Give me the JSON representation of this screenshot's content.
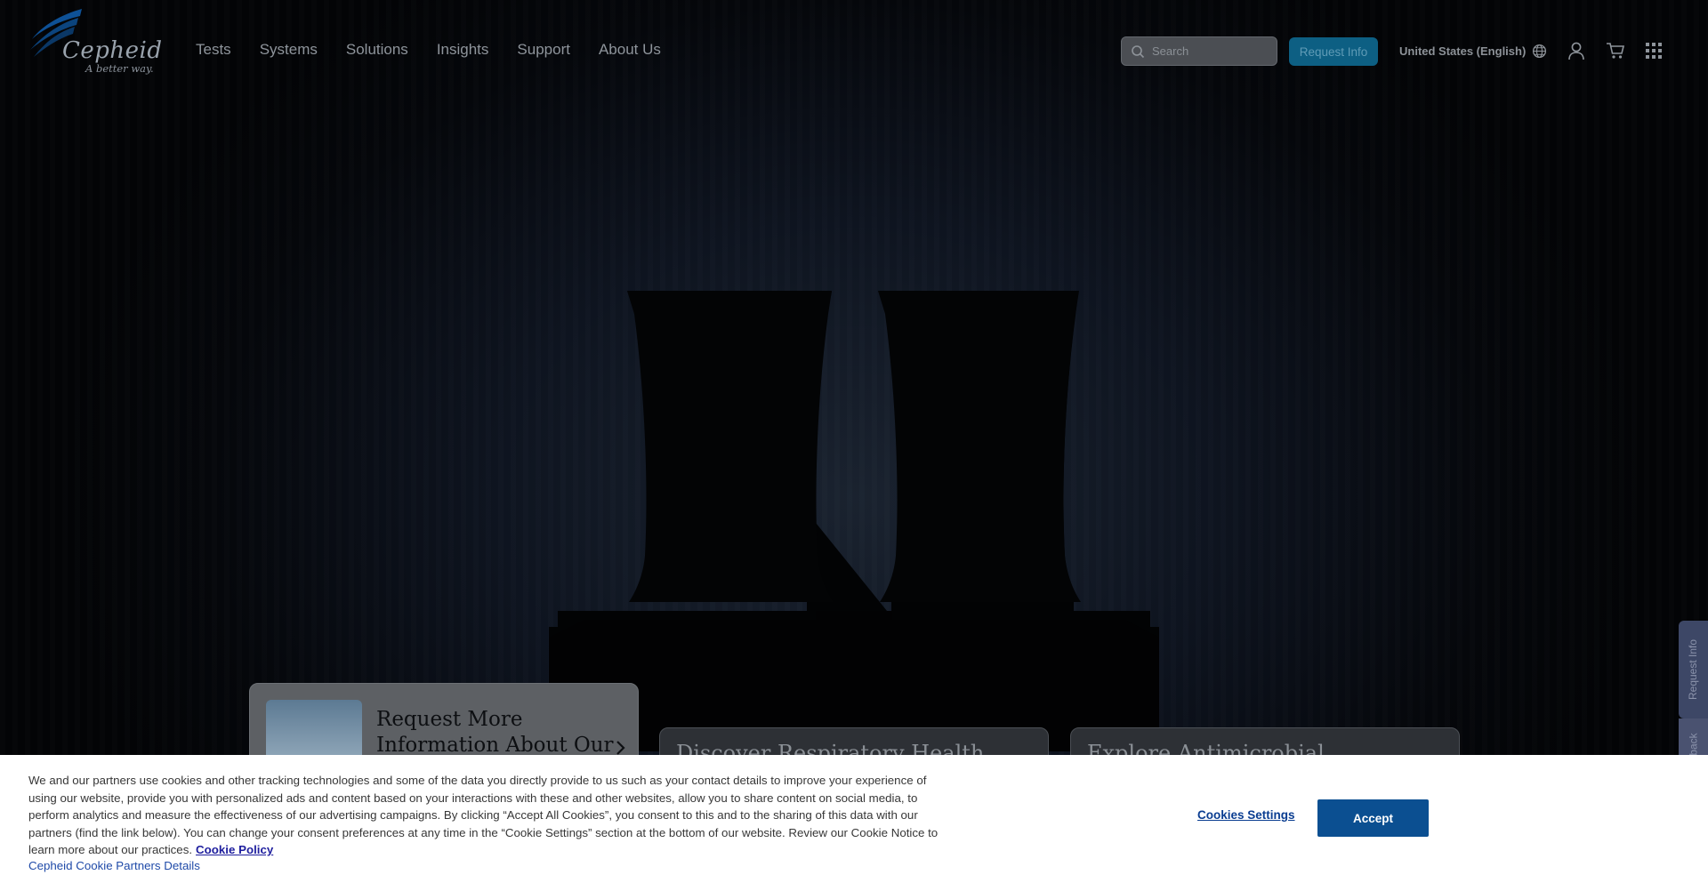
{
  "brand": {
    "name": "Cepheid",
    "tagline": "A better way.",
    "color": "#0f5aa6"
  },
  "nav": {
    "items": [
      {
        "label": "Tests"
      },
      {
        "label": "Systems"
      },
      {
        "label": "Solutions"
      },
      {
        "label": "Insights"
      },
      {
        "label": "Support"
      },
      {
        "label": "About Us"
      }
    ]
  },
  "header": {
    "search_placeholder": "Search",
    "request_info_label": "Request Info",
    "locale_label": "United States (English)",
    "icons": [
      "globe-icon",
      "user-icon",
      "cart-icon",
      "app-grid-icon"
    ]
  },
  "hero": {
    "cards": [
      {
        "title": "Request More Information About Our"
      },
      {
        "title": "Discover Respiratory Health"
      },
      {
        "title": "Explore Antimicrobial Stewardship"
      }
    ]
  },
  "side_tabs": {
    "request_info": "Request Info",
    "feedback": "back"
  },
  "cookie_banner": {
    "text": "We and our partners use cookies and other tracking technologies and some of the data you directly provide to us such as your contact details to improve your experience of using our website, provide you with personalized ads and content based on your interactions with these and other websites, allow you to share content on social media, to perform analytics and measure the effectiveness of our advertising campaigns. By clicking “Accept All Cookies”, you consent to this and to the sharing of this data with our partners (find the link below). You can change your consent preferences at any time in the “Cookie Settings” section at the bottom of our website. Review our Cookie Notice to learn more about our practices.",
    "policy_link": "Cookie Policy",
    "partners_link": "Cepheid Cookie Partners Details",
    "settings_label": "Cookies Settings",
    "accept_label": "Accept",
    "accent": "#0b4f91"
  }
}
